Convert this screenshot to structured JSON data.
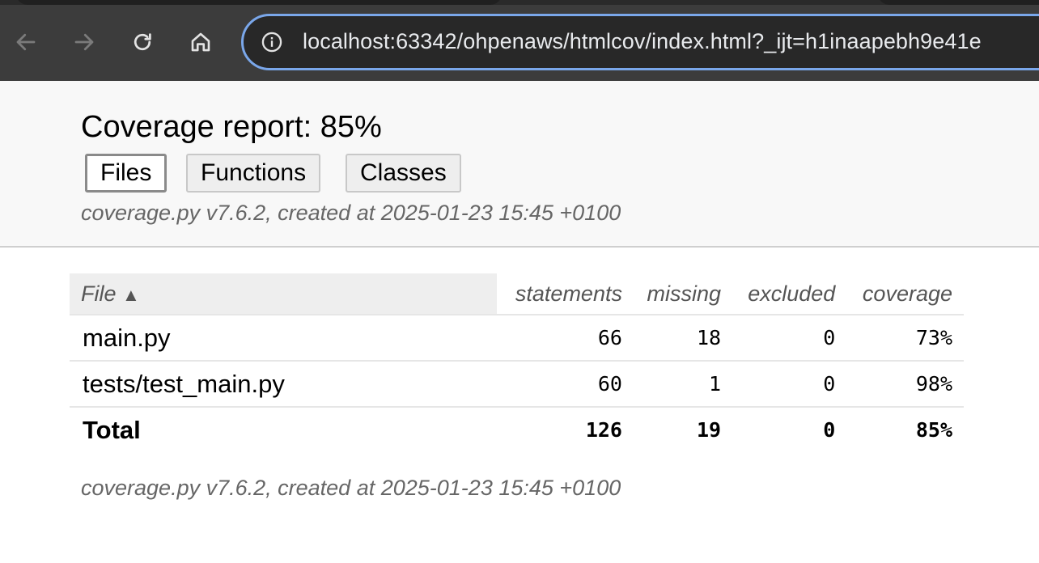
{
  "browser": {
    "url": "localhost:63342/ohpenaws/htmlcov/index.html?_ijt=h1inaapebh9e41e"
  },
  "header": {
    "title": "Coverage report: 85%",
    "buttons": {
      "files": "Files",
      "functions": "Functions",
      "classes": "Classes"
    },
    "meta": "coverage.py v7.6.2, created at 2025-01-23 15:45 +0100"
  },
  "table": {
    "columns": {
      "file": "File",
      "sort_indicator": "▲",
      "statements": "statements",
      "missing": "missing",
      "excluded": "excluded",
      "coverage": "coverage"
    },
    "rows": [
      {
        "file": "main.py",
        "statements": "66",
        "missing": "18",
        "excluded": "0",
        "coverage": "73%"
      },
      {
        "file": "tests/test_main.py",
        "statements": "60",
        "missing": "1",
        "excluded": "0",
        "coverage": "98%"
      }
    ],
    "total": {
      "file": "Total",
      "statements": "126",
      "missing": "19",
      "excluded": "0",
      "coverage": "85%"
    }
  },
  "footer": {
    "meta": "coverage.py v7.6.2, created at 2025-01-23 15:45 +0100"
  },
  "icons": [
    "back-arrow-icon",
    "forward-arrow-icon",
    "reload-icon",
    "home-icon",
    "info-icon"
  ]
}
